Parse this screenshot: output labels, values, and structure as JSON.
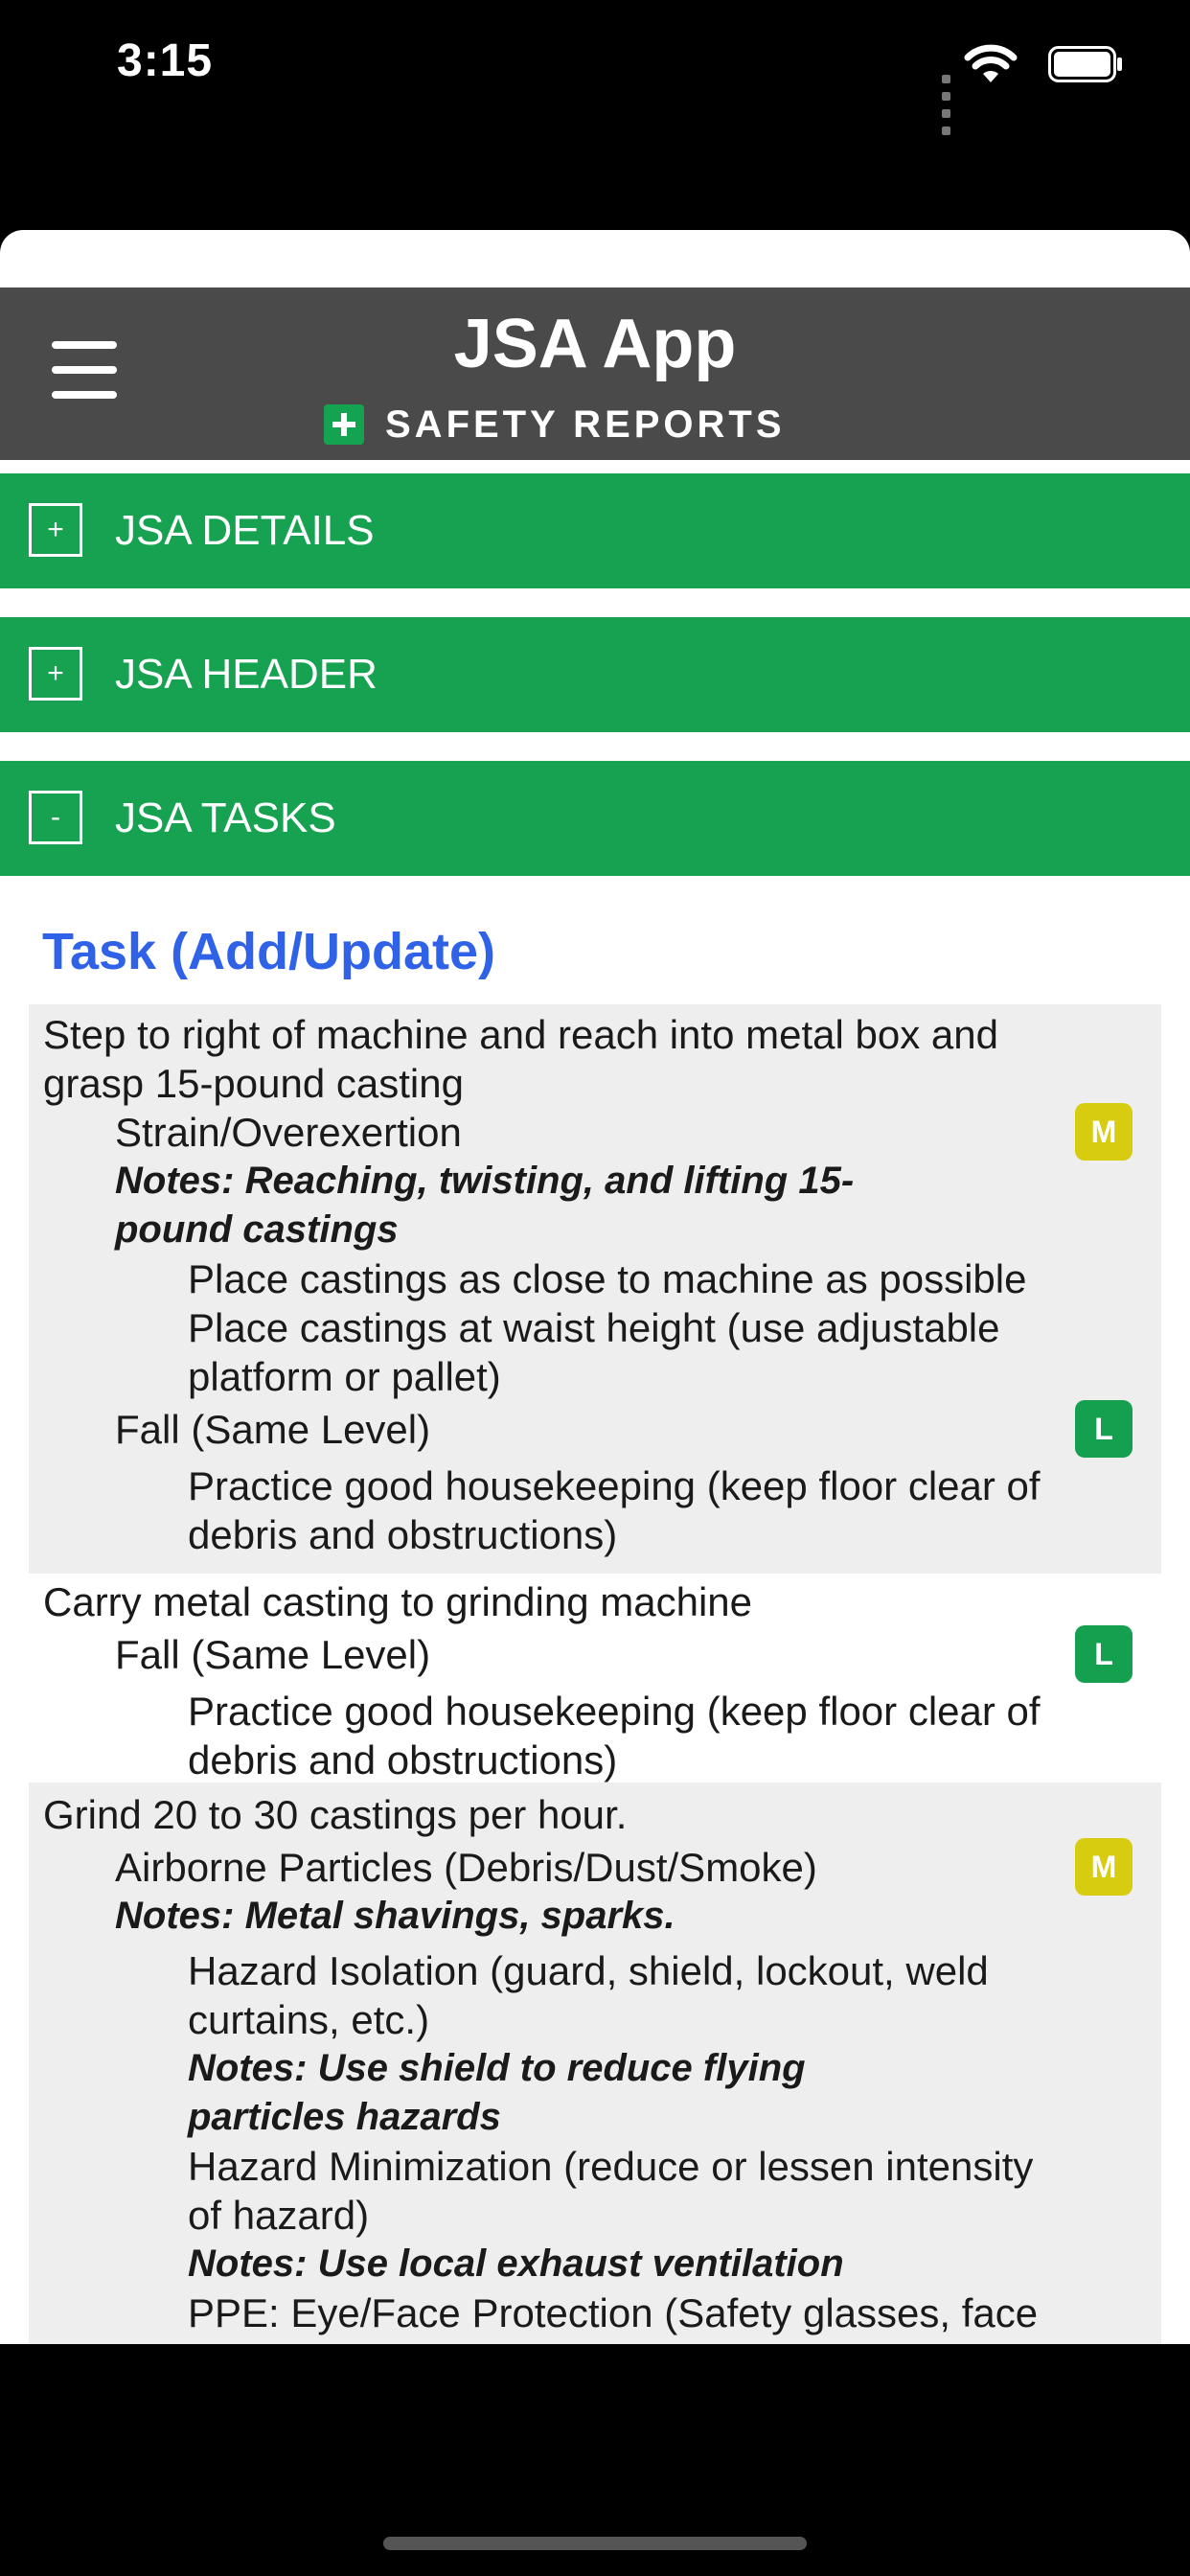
{
  "status_bar": {
    "time": "3:15"
  },
  "header": {
    "title": "JSA App",
    "brand": "SAFETY REPORTS"
  },
  "sections": [
    {
      "toggle": "+",
      "label": "JSA DETAILS"
    },
    {
      "toggle": "+",
      "label": "JSA HEADER"
    },
    {
      "toggle": "-",
      "label": "JSA TASKS"
    }
  ],
  "tasks_heading": "Task (Add/Update)",
  "tasks": [
    {
      "step_lines": [
        "Step to right of machine and reach into metal box and",
        "grasp 15-pound casting"
      ],
      "hazards": [
        {
          "name": "Strain/Overexertion",
          "risk": "M",
          "notes_lines": [
            "Notes: Reaching, twisting, and lifting 15-",
            "pound castings"
          ],
          "controls": [
            {
              "lines": [
                "Place castings as close to machine as possible"
              ]
            },
            {
              "lines": [
                "Place castings at waist height (use adjustable",
                "platform or pallet)"
              ]
            }
          ]
        },
        {
          "name": "Fall (Same Level)",
          "risk": "L",
          "controls": [
            {
              "lines": [
                "Practice good housekeeping (keep floor clear of",
                "debris and obstructions)"
              ]
            }
          ]
        }
      ]
    },
    {
      "step_lines": [
        "Carry metal casting to grinding machine"
      ],
      "hazards": [
        {
          "name": "Fall (Same Level)",
          "risk": "L",
          "controls": [
            {
              "lines": [
                "Practice good housekeeping (keep floor clear of",
                "debris and obstructions)"
              ]
            }
          ]
        }
      ]
    },
    {
      "step_lines": [
        "Grind 20 to 30 castings per hour."
      ],
      "hazards": [
        {
          "name": "Airborne Particles (Debris/Dust/Smoke)",
          "risk": "M",
          "notes_lines": [
            "Notes: Metal shavings, sparks."
          ],
          "controls": [
            {
              "lines": [
                "Hazard Isolation (guard, shield, lockout, weld",
                "curtains, etc.)"
              ],
              "notes_lines": [
                "Notes: Use shield to reduce flying",
                "particles hazards"
              ]
            },
            {
              "lines": [
                "Hazard Minimization (reduce or lessen intensity",
                "of hazard)"
              ],
              "notes_lines": [
                "Notes: Use local exhaust ventilation"
              ]
            },
            {
              "lines": [
                "PPE: Eye/Face Protection (Safety glasses, face"
              ]
            }
          ]
        }
      ]
    }
  ]
}
